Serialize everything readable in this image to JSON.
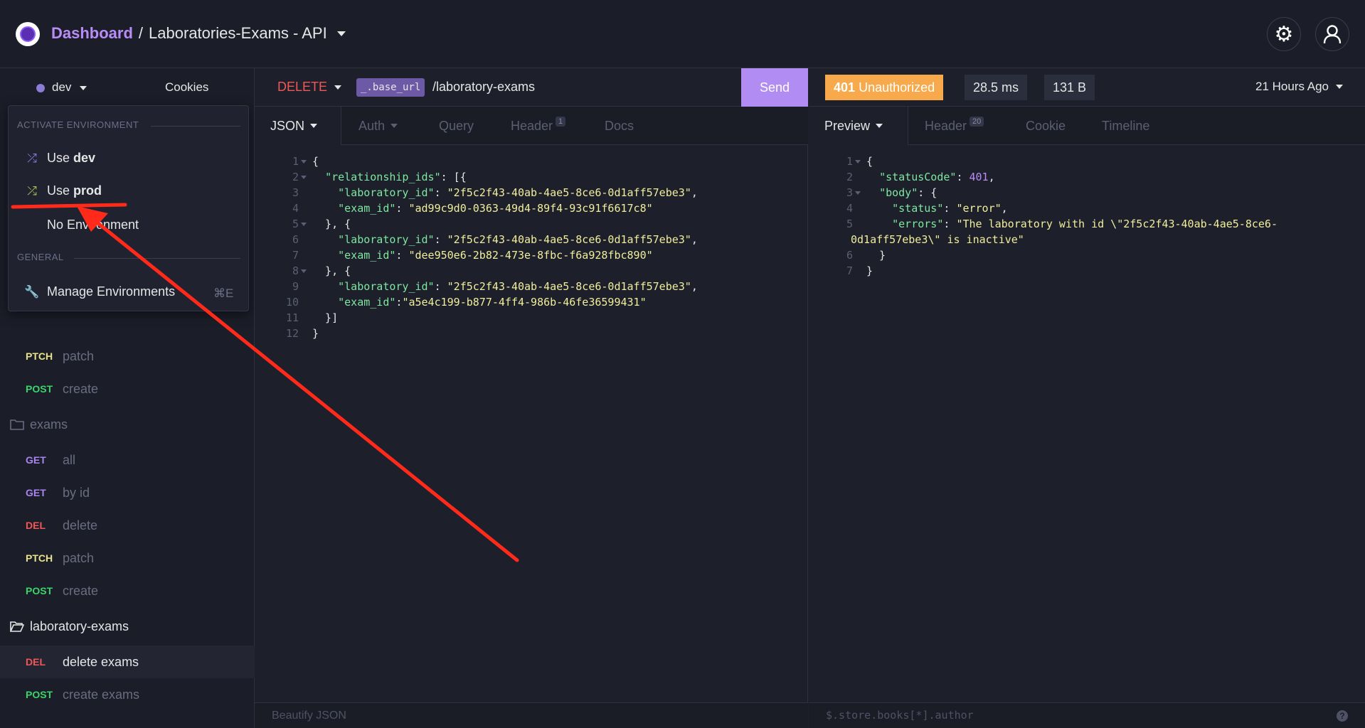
{
  "header": {
    "dashboard_label": "Dashboard",
    "separator": "/",
    "project_name": "Laboratories-Exams - API",
    "gear_icon": "⚙",
    "user_icon": "👤"
  },
  "sidebar": {
    "environment": "dev",
    "cookies_label": "Cookies",
    "dropdown": {
      "section_activate": "ACTIVATE ENVIRONMENT",
      "use_prefix": "Use",
      "dev_env": "dev",
      "prod_env": "prod",
      "no_env": "No Environment",
      "section_general": "GENERAL",
      "manage_label": "Manage Environments",
      "manage_shortcut": "⌘E"
    },
    "items": [
      {
        "method": "PTCH",
        "name": "patch"
      },
      {
        "method": "POST",
        "name": "create"
      }
    ],
    "folder_exams": "exams",
    "exams_items": [
      {
        "method": "GET",
        "name": "all"
      },
      {
        "method": "GET",
        "name": "by id"
      },
      {
        "method": "DEL",
        "name": "delete"
      },
      {
        "method": "PTCH",
        "name": "patch"
      },
      {
        "method": "POST",
        "name": "create"
      }
    ],
    "folder_lab_exams": "laboratory-exams",
    "lab_exams_items": [
      {
        "method": "DEL",
        "name": "delete exams"
      },
      {
        "method": "POST",
        "name": "create exams"
      }
    ]
  },
  "request": {
    "method": "DELETE",
    "base_url_var": "_.base_url",
    "path": "/laboratory-exams",
    "send_label": "Send",
    "tabs": {
      "json": "JSON",
      "auth": "Auth",
      "query": "Query",
      "header": "Header",
      "header_count": "1",
      "docs": "Docs"
    },
    "body_lines": [
      "{",
      "  \"relationship_ids\": [{",
      "    \"laboratory_id\": \"2f5c2f43-40ab-4ae5-8ce6-0d1aff57ebe3\",",
      "    \"exam_id\": \"ad99c9d0-0363-49d4-89f4-93c91f6617c8\"",
      "  }, {",
      "    \"laboratory_id\": \"2f5c2f43-40ab-4ae5-8ce6-0d1aff57ebe3\",",
      "    \"exam_id\": \"dee950e6-2b82-473e-8fbc-f6a928fbc890\"",
      "  }, {",
      "    \"laboratory_id\": \"2f5c2f43-40ab-4ae5-8ce6-0d1aff57ebe3\",",
      "    \"exam_id\":\"a5e4c199-b877-4ff4-986b-46fe36599431\"",
      "  }]",
      "}"
    ],
    "footer_label": "Beautify JSON"
  },
  "response": {
    "status_code": "401",
    "status_text": "Unauthorized",
    "time": "28.5 ms",
    "size": "131 B",
    "ago": "21 Hours Ago",
    "tabs": {
      "preview": "Preview",
      "header": "Header",
      "header_count": "20",
      "cookie": "Cookie",
      "timeline": "Timeline"
    },
    "filter_placeholder": "$.store.books[*].author",
    "help_icon": "?"
  },
  "colors": {
    "accent": "#b18cf2",
    "status_warning": "#f8a94c",
    "method_delete": "#f25757",
    "annotation": "#ff2a1a"
  }
}
